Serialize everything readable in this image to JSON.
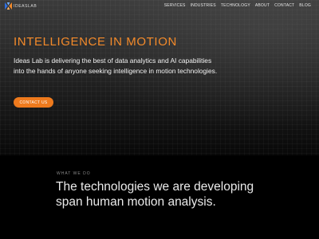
{
  "brand": {
    "logo_text": "IDEASLAB",
    "accent_color": "#f38a2a",
    "button_color": "#ee7a1d"
  },
  "nav": {
    "items": [
      {
        "label": "SERVICES"
      },
      {
        "label": "INDUSTRIES"
      },
      {
        "label": "TECHNOLOGY"
      },
      {
        "label": "ABOUT"
      },
      {
        "label": "CONTACT"
      },
      {
        "label": "BLOG"
      }
    ]
  },
  "hero": {
    "title": "INTELLIGENCE IN MOTION",
    "text": "Ideas Lab is delivering the best of data analytics and AI capabilities into the hands of anyone seeking intelligence in motion technologies.",
    "cta_label": "CONTACT US"
  },
  "section": {
    "label": "WHAT WE DO",
    "heading": "The technologies we are developing span human motion analysis."
  }
}
